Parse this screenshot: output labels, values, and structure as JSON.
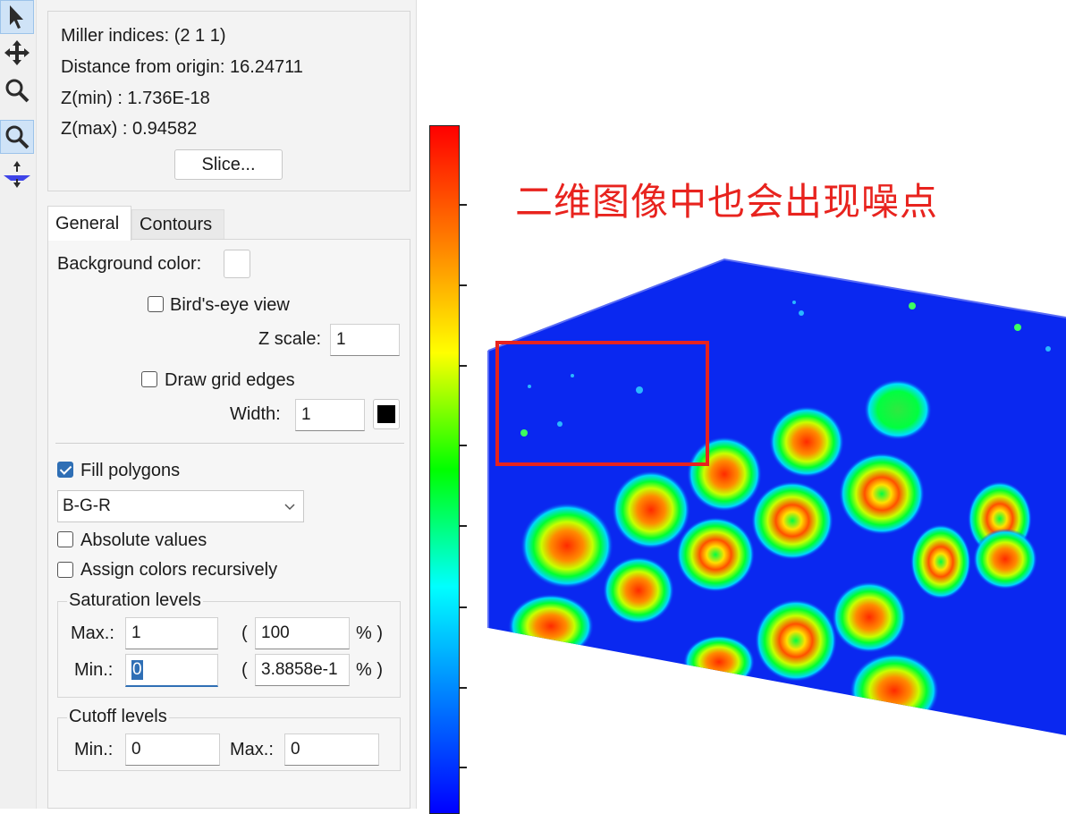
{
  "toolbar": {
    "tools": [
      {
        "icon": "pointer-icon"
      },
      {
        "icon": "move-icon"
      },
      {
        "icon": "zoom-icon"
      },
      {
        "icon": "zoom-box-icon"
      },
      {
        "icon": "slice-plane-icon"
      }
    ]
  },
  "info": {
    "miller": "Miller indices: (2 1 1)",
    "distance": "Distance from origin: 16.24711",
    "zmin": "Z(min) : 1.736E-18",
    "zmax": "Z(max) : 0.94582",
    "slice_button": "Slice..."
  },
  "tabs": [
    {
      "label": "General",
      "active": true
    },
    {
      "label": "Contours",
      "active": false
    }
  ],
  "general": {
    "background_color_label": "Background color:",
    "birds_eye_label": "Bird's-eye view",
    "birds_eye_checked": false,
    "z_scale_label": "Z scale:",
    "z_scale_value": "1",
    "draw_grid_label": "Draw grid edges",
    "draw_grid_checked": false,
    "width_label": "Width:",
    "width_value": "1",
    "edge_color": "#000000",
    "fill_polygons_label": "Fill polygons",
    "fill_polygons_checked": true,
    "colormap_value": "B-G-R",
    "absolute_values_label": "Absolute values",
    "absolute_values_checked": false,
    "assign_colors_label": "Assign colors recursively",
    "assign_colors_checked": false
  },
  "saturation": {
    "title": "Saturation levels",
    "max_label": "Max.:",
    "max_value": "1",
    "max_pct": "100",
    "min_label": "Min.:",
    "min_value": "0",
    "min_pct": "3.8858e-1",
    "open_paren": "(",
    "pct_close": "% )"
  },
  "cutoff": {
    "title": "Cutoff levels",
    "min_label": "Min.:",
    "min_value": "0",
    "max_label": "Max.:",
    "max_value": "0"
  },
  "plot": {
    "annotation": "二维图像中也会出现噪点",
    "colorbar_colors": [
      "#ff0000",
      "#ff8000",
      "#ffff00",
      "#00ff00",
      "#00ffff",
      "#0080ff",
      "#0000ff"
    ],
    "highlight_color": "#e8231e",
    "surface_color": "#0a28f0"
  }
}
